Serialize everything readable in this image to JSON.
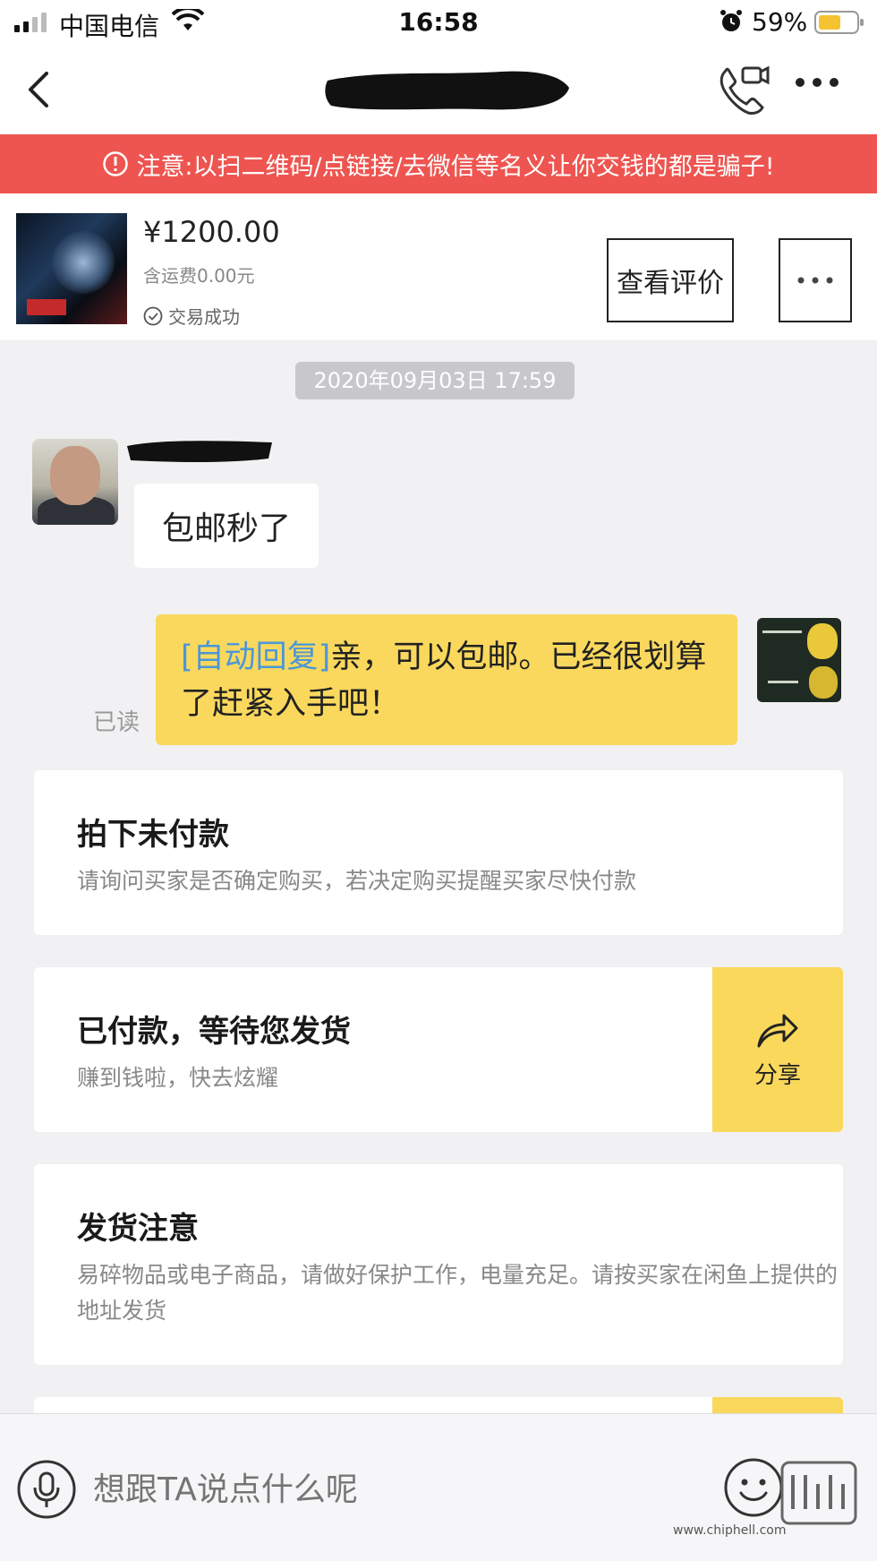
{
  "status_bar": {
    "carrier": "中国电信",
    "time": "16:58",
    "battery_pct": "59%",
    "battery_level": 0.59,
    "icons": [
      "signal-icon",
      "wifi-icon",
      "alarm-icon",
      "battery-icon"
    ]
  },
  "nav": {
    "icons": [
      "back-icon",
      "video-call-icon",
      "more-icon"
    ]
  },
  "warning": {
    "text": "注意:以扫二维码/点链接/去微信等名义让你交钱的都是骗子!",
    "color": "#ee5550"
  },
  "product": {
    "price": "¥1200.00",
    "shipping": "含运费0.00元",
    "status": "交易成功",
    "review_label": "查看评价"
  },
  "chat": {
    "timestamp": "2020年09月03日 17:59",
    "messages": [
      {
        "from": "other",
        "text": "包邮秒了"
      },
      {
        "from": "me",
        "tag": "[自动回复]",
        "text": "亲，可以包邮。已经很划算了赶紧入手吧！",
        "read": "已读"
      }
    ]
  },
  "cards": [
    {
      "title": "拍下未付款",
      "desc": "请询问买家是否确定购买，若决定购买提醒买家尽快付款"
    },
    {
      "title": "已付款，等待您发货",
      "desc": "赚到钱啦，快去炫耀",
      "action": "分享"
    },
    {
      "title": "发货注意",
      "desc": "易碎物品或电子商品，请做好保护工作，电量充足。请按买家在闲鱼上提供的地址发货"
    }
  ],
  "input": {
    "placeholder": "想跟TA说点什么呢"
  },
  "watermark": {
    "url": "www.chiphell.com"
  },
  "colors": {
    "accent_yellow": "#fad85d",
    "link_blue": "#4a97d8",
    "background": "#f1f1f3"
  }
}
